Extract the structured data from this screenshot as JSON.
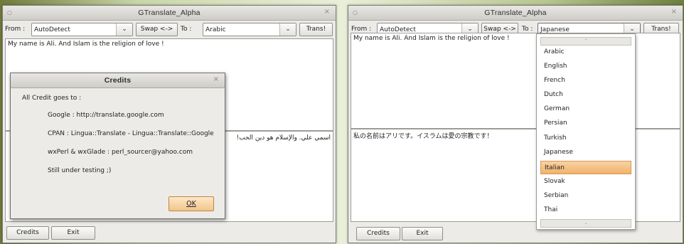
{
  "left_window": {
    "title": "GTranslate_Alpha",
    "from_label": "From :",
    "from_value": "AutoDetect",
    "swap_label": "Swap <->",
    "to_label": "To :",
    "to_value": "Arabic",
    "translate_label": "Trans!",
    "source_text": "My name is Ali. And Islam is the religion of love !",
    "result_text": "اسمي علي. والإسلام هو دين الحب!",
    "credits_label": "Credits",
    "exit_label": "Exit"
  },
  "credits_dialog": {
    "title": "Credits",
    "heading": "All Credit goes to :",
    "lines": [
      "Google : http://translate.google.com",
      "CPAN : Lingua::Translate - Lingua::Translate::Google",
      "wxPerl & wxGlade : perl_sourcer@yahoo.com",
      "Still under testing ;)"
    ],
    "ok_label": "OK"
  },
  "right_window": {
    "title": "GTranslate_Alpha",
    "from_label": "From :",
    "from_value": "AutoDetect",
    "swap_label": "Swap <->",
    "to_label": "To :",
    "to_value": "Japanese",
    "translate_label": "Trans!",
    "source_text": "My name is Ali. And Islam is the religion of love !",
    "result_text": "私の名前はアリです。イスラムは愛の宗教です！",
    "credits_label": "Credits",
    "exit_label": "Exit"
  },
  "language_dropdown": {
    "options": [
      "Arabic",
      "English",
      "French",
      "Dutch",
      "German",
      "Persian",
      "Turkish",
      "Japanese",
      "Italian",
      "Slovak",
      "Serbian",
      "Thai"
    ],
    "highlighted": "Italian"
  },
  "icons": {
    "window_menu": "○",
    "close": "×",
    "combo_arrow": "⌄",
    "scroll_up": "⌃",
    "scroll_down": "⌄"
  }
}
